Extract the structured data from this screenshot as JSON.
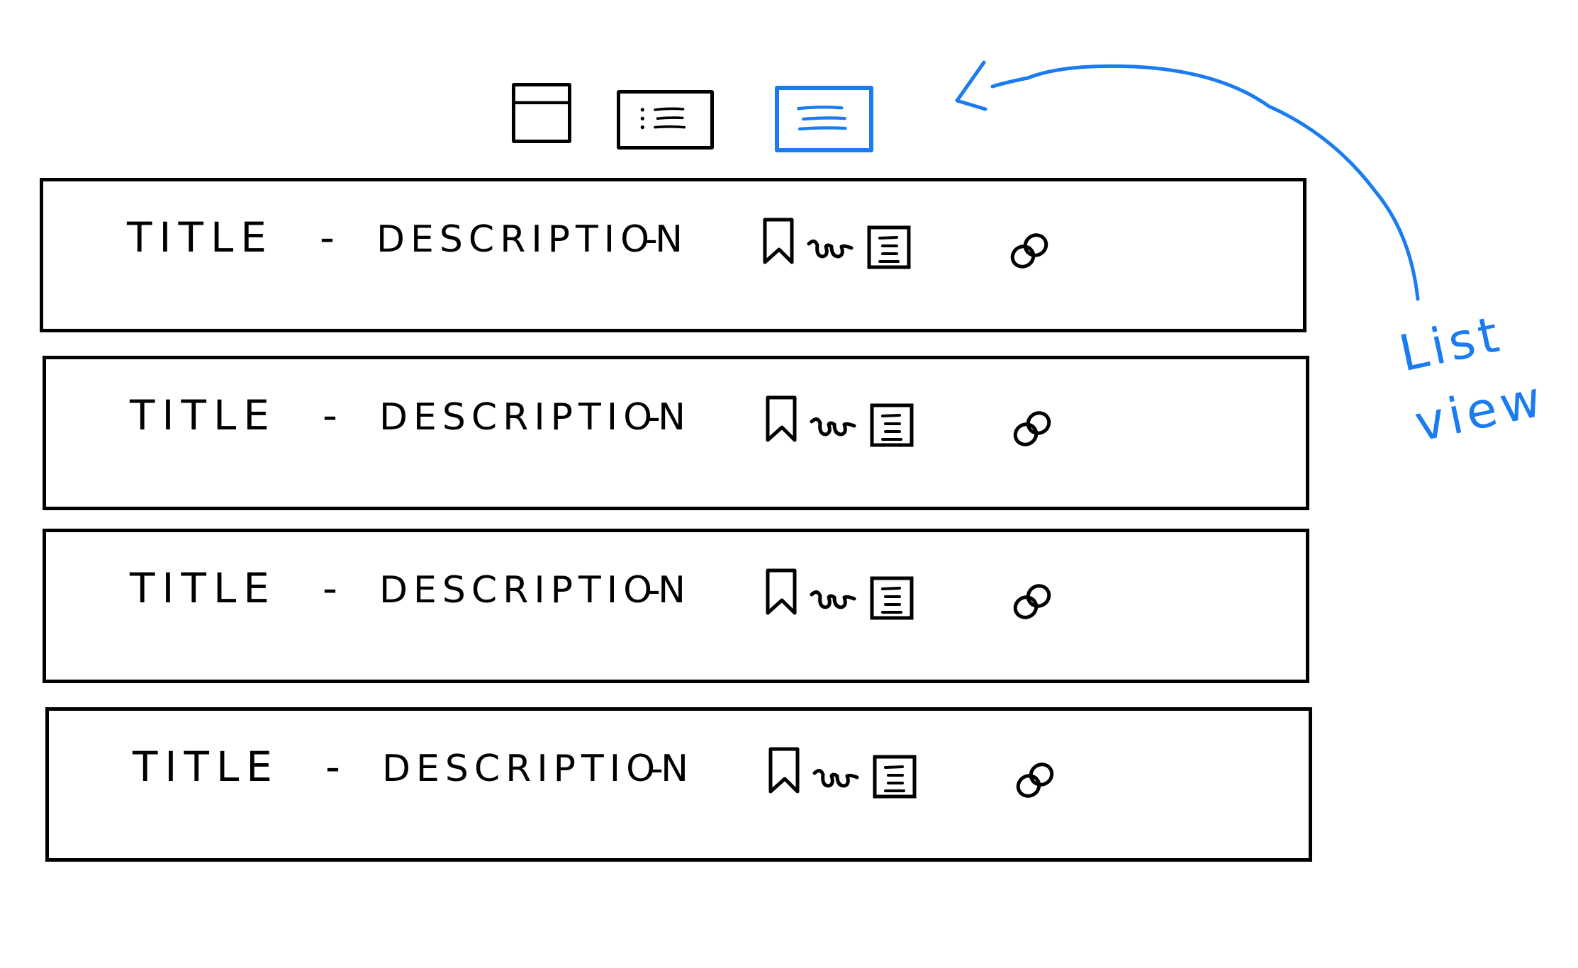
{
  "view_toggles": [
    {
      "name": "card-view",
      "icon": "card-view-icon",
      "active": false
    },
    {
      "name": "compact-list-view",
      "icon": "compact-list-icon",
      "active": false
    },
    {
      "name": "list-view",
      "icon": "list-view-icon",
      "active": true
    }
  ],
  "rows": [
    {
      "title": "TITLE",
      "separator": "-",
      "description": "DESCRIPTION",
      "trailing": "-"
    },
    {
      "title": "TITLE",
      "separator": "-",
      "description": "DESCRIPTION",
      "trailing": "-"
    },
    {
      "title": "TITLE",
      "separator": "-",
      "description": "DESCRIPTION",
      "trailing": "-"
    },
    {
      "title": "TITLE",
      "separator": "-",
      "description": "DESCRIPTION",
      "trailing": "-"
    }
  ],
  "row_icons": [
    "bookmark-icon",
    "glasses-icon",
    "note-icon",
    "link-icon"
  ],
  "annotation": {
    "line1": "List",
    "line2": "view",
    "color": "#1a7cf0"
  }
}
